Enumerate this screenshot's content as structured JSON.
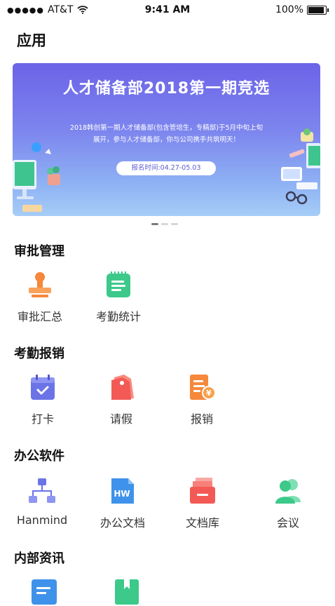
{
  "status_bar": {
    "carrier": "AT&T",
    "time": "9:41 AM",
    "battery": "100%"
  },
  "page_title": "应用",
  "banner": {
    "title": "人才储备部2018第一期竞选",
    "desc_line1": "2018韩创第一期人才储备部(包含管培生，专精部)于5月中旬上旬",
    "desc_line2": "展开，参与人才储备部，你与公司携手共筑明天！",
    "pill": "报名时间:04.27-05.03"
  },
  "sections": {
    "approval": {
      "title": "审批管理",
      "items": [
        {
          "label": "审批汇总",
          "icon": "stamp-icon"
        },
        {
          "label": "考勤统计",
          "icon": "clipboard-icon"
        }
      ]
    },
    "attendance": {
      "title": "考勤报销",
      "items": [
        {
          "label": "打卡",
          "icon": "calendar-check-icon"
        },
        {
          "label": "请假",
          "icon": "tag-icon"
        },
        {
          "label": "报销",
          "icon": "receipt-yen-icon"
        }
      ]
    },
    "office": {
      "title": "办公软件",
      "items": [
        {
          "label": "Hanmind",
          "icon": "mindmap-icon"
        },
        {
          "label": "办公文档",
          "icon": "document-icon"
        },
        {
          "label": "文档库",
          "icon": "archive-icon"
        },
        {
          "label": "会议",
          "icon": "people-icon"
        }
      ]
    },
    "news": {
      "title": "内部资讯",
      "items": [
        {
          "icon": "news-icon"
        },
        {
          "icon": "bookmark-book-icon"
        }
      ]
    }
  },
  "colors": {
    "banner_top": "#6c63e8",
    "orange": "#f5883a",
    "green": "#3cc98a",
    "indigo": "#6b74e6",
    "red": "#f35a55",
    "blue": "#3f92ea"
  }
}
